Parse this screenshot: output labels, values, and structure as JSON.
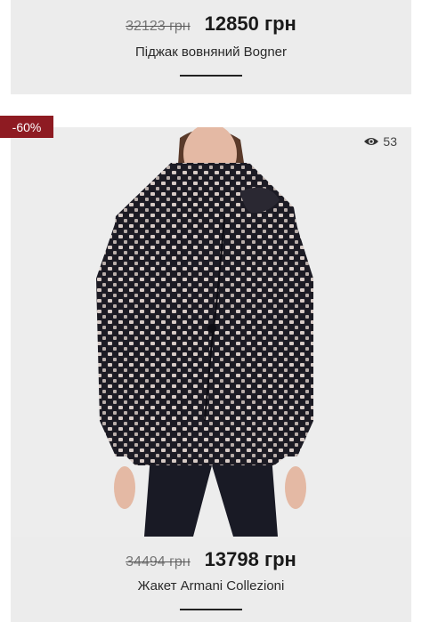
{
  "products": [
    {
      "old_price": "32123 грн",
      "new_price": "12850 грн",
      "name": "Піджак вовняний Bogner"
    },
    {
      "discount_badge": "-60%",
      "views": "53",
      "image": "woman-in-houndstooth-jacket-photo",
      "old_price": "34494 грн",
      "new_price": "13798 грн",
      "name": "Жакет Armani Collezioni"
    }
  ]
}
